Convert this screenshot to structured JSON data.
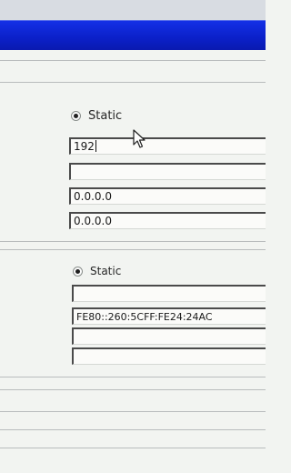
{
  "ipv4": {
    "mode_label": "Static",
    "address": "192",
    "subnet_mask": "",
    "default_gateway": "0.0.0.0",
    "dns_server": "0.0.0.0"
  },
  "ipv6": {
    "mode_label": "Static",
    "address": "",
    "link_local": "FE80::260:5CFF:FE24:24AC",
    "gateway": "",
    "dns": ""
  },
  "colors": {
    "titlebar": "#0b20c8",
    "background": "#f2f4f1"
  }
}
